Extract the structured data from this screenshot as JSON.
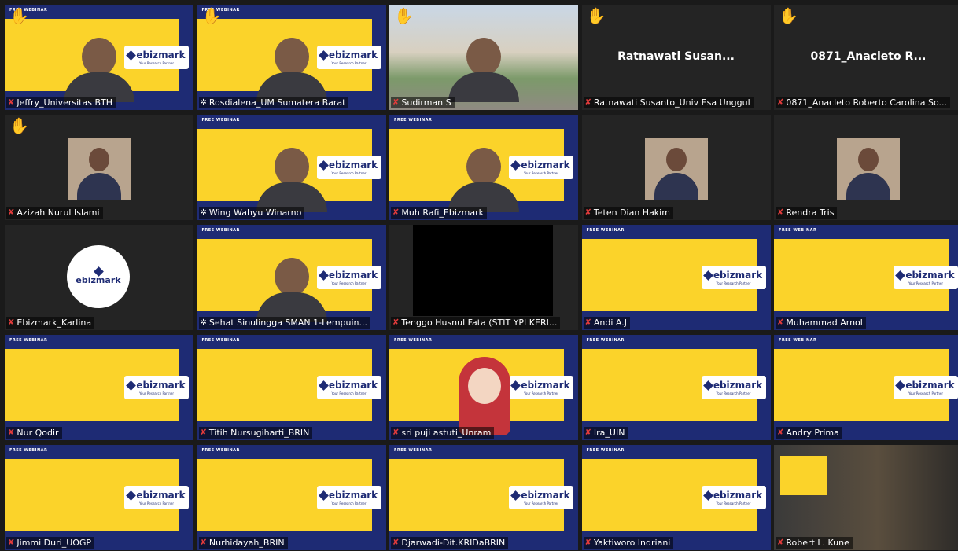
{
  "meeting": {
    "slide": {
      "tag": "FREE WEBINAR",
      "brand": "ebizmark",
      "brand_tagline": "Your Research Partner"
    },
    "participants": [
      {
        "label": "Jeffry_Universitas BTH",
        "mic": "muted",
        "hand_raised": true,
        "tile": "slide-person"
      },
      {
        "label": "Rosdialena_UM Sumatera Barat",
        "mic": "pinned",
        "hand_raised": true,
        "tile": "slide-person"
      },
      {
        "label": "Sudirman S",
        "mic": "muted",
        "hand_raised": true,
        "tile": "outdoor-video"
      },
      {
        "label": "Ratnawati Susanto_Univ Esa Unggul",
        "display_name": "Ratnawati  Susan...",
        "mic": "muted",
        "hand_raised": true,
        "tile": "name-only"
      },
      {
        "label": "0871_Anacleto Roberto Carolina So...",
        "display_name": "0871_Anacleto  R...",
        "mic": "muted",
        "hand_raised": true,
        "tile": "name-only"
      },
      {
        "label": "Azizah Nurul Islami",
        "mic": "muted",
        "hand_raised": true,
        "tile": "photo"
      },
      {
        "label": "Wing Wahyu Winarno",
        "mic": "pinned",
        "hand_raised": false,
        "tile": "slide-person",
        "active_speaker": true
      },
      {
        "label": "Muh Rafi_Ebizmark",
        "mic": "muted-pinned",
        "hand_raised": false,
        "tile": "slide-person"
      },
      {
        "label": "Teten Dian Hakim",
        "mic": "muted",
        "hand_raised": false,
        "tile": "photo"
      },
      {
        "label": "Rendra Tris",
        "mic": "muted",
        "hand_raised": false,
        "tile": "photo"
      },
      {
        "label": "Ebizmark_Karlina",
        "mic": "muted",
        "hand_raised": false,
        "tile": "circle-logo"
      },
      {
        "label": "Sehat Sinulingga SMAN 1-Lempuin...",
        "mic": "pinned",
        "hand_raised": false,
        "tile": "slide-person"
      },
      {
        "label": "Tenggo Husnul Fata (STIT YPI KERI...",
        "mic": "muted",
        "hand_raised": false,
        "tile": "black"
      },
      {
        "label": "Andi A.J",
        "mic": "muted",
        "hand_raised": false,
        "tile": "slide"
      },
      {
        "label": "Muhammad Arnol",
        "mic": "muted",
        "hand_raised": false,
        "tile": "slide"
      },
      {
        "label": "Nur Qodir",
        "mic": "muted",
        "hand_raised": false,
        "tile": "slide"
      },
      {
        "label": "Titih Nursugiharti_BRIN",
        "mic": "muted",
        "hand_raised": false,
        "tile": "slide"
      },
      {
        "label": "sri puji astuti_Unram",
        "mic": "muted",
        "hand_raised": false,
        "tile": "avatar"
      },
      {
        "label": "Ira_UIN",
        "mic": "muted",
        "hand_raised": false,
        "tile": "slide"
      },
      {
        "label": "Andry Prima",
        "mic": "muted",
        "hand_raised": false,
        "tile": "slide"
      },
      {
        "label": "Jimmi Duri_UOGP",
        "mic": "muted",
        "hand_raised": false,
        "tile": "slide"
      },
      {
        "label": "Nurhidayah_BRIN",
        "mic": "muted",
        "hand_raised": false,
        "tile": "slide"
      },
      {
        "label": "Djarwadi-Dit.KRIDaBRIN",
        "mic": "muted",
        "hand_raised": false,
        "tile": "slide"
      },
      {
        "label": "Yaktiworo Indriani",
        "mic": "muted",
        "hand_raised": false,
        "tile": "slide"
      },
      {
        "label": "Robert L. Kune",
        "mic": "muted",
        "hand_raised": false,
        "tile": "room"
      }
    ]
  }
}
